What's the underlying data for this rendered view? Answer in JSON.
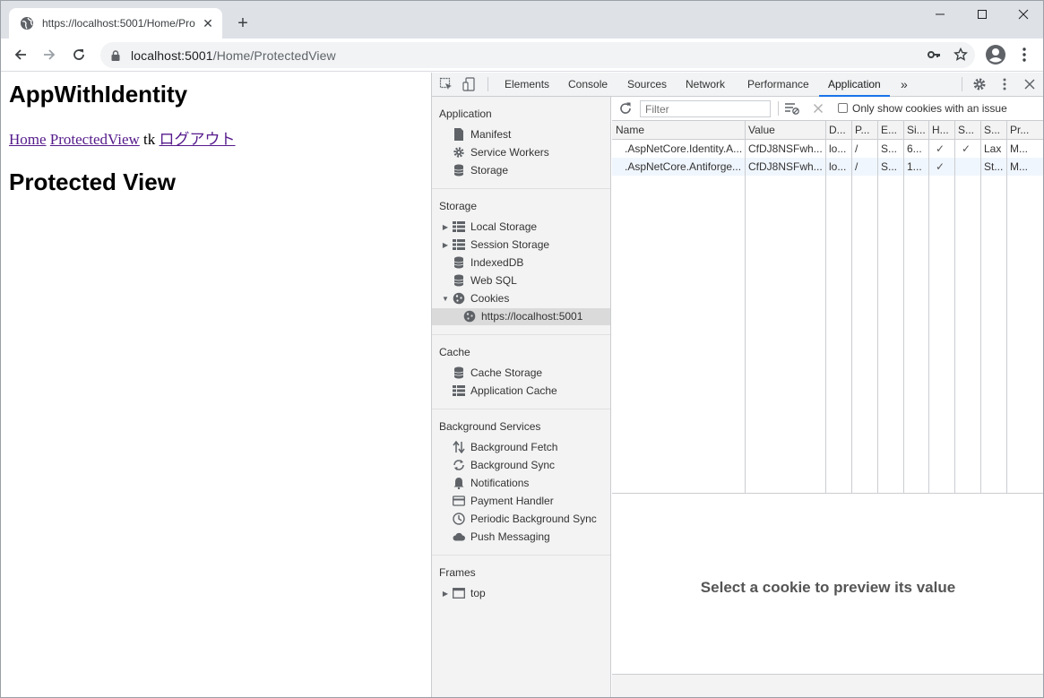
{
  "browser": {
    "tab_title": "https://localhost:5001/Home/Pro",
    "url_host": "localhost:5001",
    "url_path": "/Home/ProtectedView"
  },
  "page": {
    "heading": "AppWithIdentity",
    "nav": {
      "home": "Home",
      "protected": "ProtectedView",
      "user": "tk",
      "logout": "ログアウト"
    },
    "title": "Protected View"
  },
  "devtools": {
    "tabs": [
      "Elements",
      "Console",
      "Sources",
      "Network",
      "Performance",
      "Application"
    ],
    "active_tab": "Application",
    "more": "»",
    "sidebar": {
      "application_header": "Application",
      "application_items": [
        "Manifest",
        "Service Workers",
        "Storage"
      ],
      "storage_header": "Storage",
      "storage_items": [
        "Local Storage",
        "Session Storage",
        "IndexedDB",
        "Web SQL",
        "Cookies"
      ],
      "cookie_origin": "https://localhost:5001",
      "cache_header": "Cache",
      "cache_items": [
        "Cache Storage",
        "Application Cache"
      ],
      "bg_header": "Background Services",
      "bg_items": [
        "Background Fetch",
        "Background Sync",
        "Notifications",
        "Payment Handler",
        "Periodic Background Sync",
        "Push Messaging"
      ],
      "frames_header": "Frames",
      "frames_items": [
        "top"
      ]
    },
    "filter_placeholder": "Filter",
    "only_issues_label": "Only show cookies with an issue",
    "columns": [
      "Name",
      "Value",
      "D...",
      "P...",
      "E...",
      "Si...",
      "H...",
      "S...",
      "S...",
      "Pr..."
    ],
    "rows": [
      [
        ".AspNetCore.Identity.A...",
        "CfDJ8NSFwh...",
        "lo...",
        "/",
        "S...",
        "6...",
        "✓",
        "✓",
        "Lax",
        "M..."
      ],
      [
        ".AspNetCore.Antiforge...",
        "CfDJ8NSFwh...",
        "lo...",
        "/",
        "S...",
        "1...",
        "✓",
        "",
        "St...",
        "M..."
      ]
    ],
    "preview_text": "Select a cookie to preview its value"
  }
}
